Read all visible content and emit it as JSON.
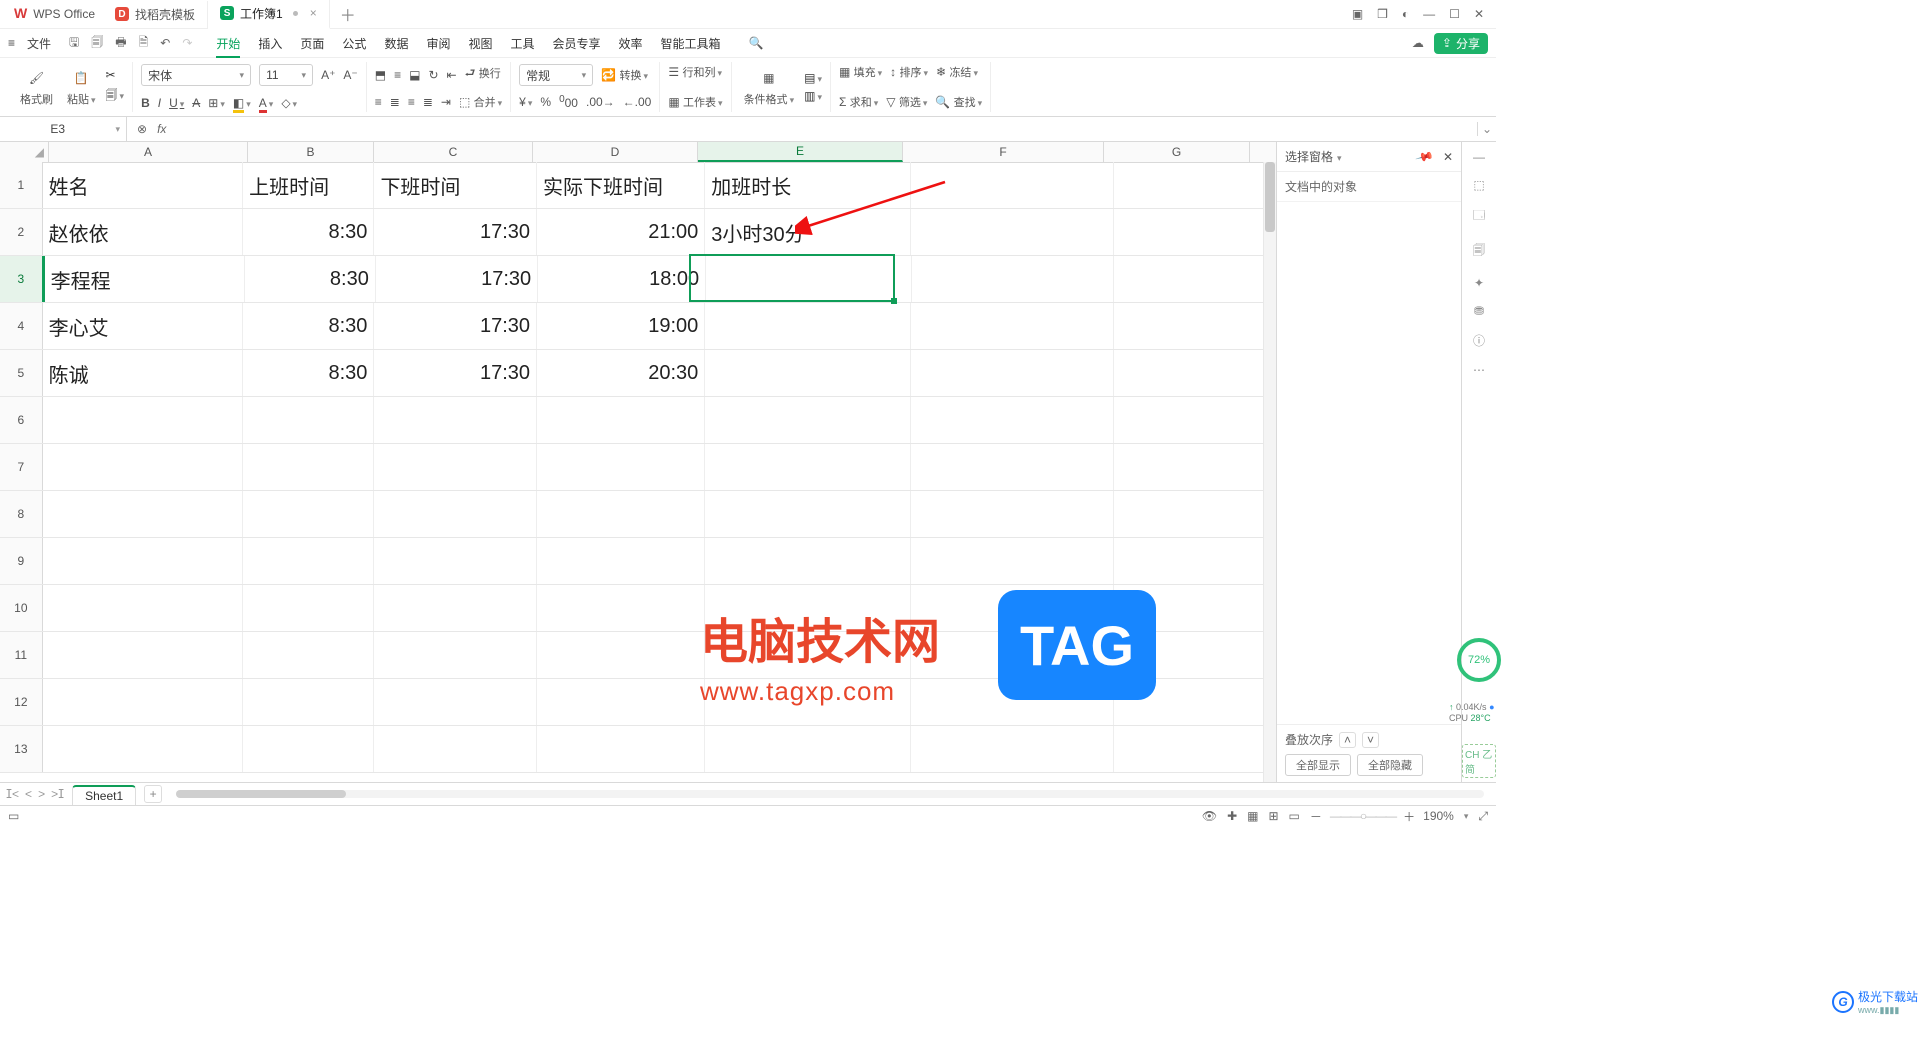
{
  "titlebar": {
    "brand": "WPS Office",
    "tabs": [
      {
        "icon": "red",
        "icon_text": "D",
        "label": "找稻壳模板"
      },
      {
        "icon": "green",
        "icon_text": "S",
        "label": "工作簿1",
        "active": true,
        "dirty": true
      }
    ]
  },
  "menubar": {
    "file": "文件",
    "tabs": [
      "开始",
      "插入",
      "页面",
      "公式",
      "数据",
      "审阅",
      "视图",
      "工具",
      "会员专享",
      "效率",
      "智能工具箱"
    ],
    "active_tab": "开始",
    "share": "分享"
  },
  "ribbon": {
    "format_painter": "格式刷",
    "paste": "粘贴",
    "font_name": "宋体",
    "font_size": "11",
    "wrap": "换行",
    "merge": "合并",
    "number_format": "常规",
    "convert": "转换",
    "rowcol": "行和列",
    "worksheet": "工作表",
    "cond_format": "条件格式",
    "fill": "填充",
    "sort": "排序",
    "freeze": "冻结",
    "sum": "求和",
    "filter": "筛选",
    "find": "查找"
  },
  "fxbar": {
    "namebox": "E3",
    "formula": ""
  },
  "sheet": {
    "active_cell": "E3",
    "columns": [
      "A",
      "B",
      "C",
      "D",
      "E",
      "F",
      "G"
    ],
    "selected_col": "E",
    "selected_row": 3,
    "row_headers": [
      1,
      2,
      3,
      4,
      5,
      6,
      7,
      8,
      9,
      10,
      11,
      12,
      13
    ],
    "headers": {
      "A": "姓名",
      "B": "上班时间",
      "C": "下班时间",
      "D": "实际下班时间",
      "E": "加班时长"
    },
    "rows": [
      {
        "A": "赵依依",
        "B": "8:30",
        "C": "17:30",
        "D": "21:00",
        "E": "3小时30分"
      },
      {
        "A": "李程程",
        "B": "8:30",
        "C": "17:30",
        "D": "18:00",
        "E": ""
      },
      {
        "A": "李心艾",
        "B": "8:30",
        "C": "17:30",
        "D": "19:00",
        "E": ""
      },
      {
        "A": "陈诚",
        "B": "8:30",
        "C": "17:30",
        "D": "20:30",
        "E": ""
      }
    ]
  },
  "taskpane": {
    "title": "选择窗格",
    "subtitle": "文档中的对象",
    "stack_order": "叠放次序",
    "show_all": "全部显示",
    "hide_all": "全部隐藏"
  },
  "gauge": {
    "value": "72",
    "unit": "%"
  },
  "sysmon": {
    "net": "0.04K/s",
    "cpu_label": "CPU",
    "cpu": "28°C"
  },
  "ime": "CH 乙简",
  "brand_dl": {
    "name": "极光下载站",
    "sub": "www.▮▮▮▮"
  },
  "sheettabs": {
    "active": "Sheet1"
  },
  "status": {
    "zoom": "190%"
  },
  "watermark": {
    "t1": "电脑技术网",
    "t2": "www.tagxp.com",
    "tag": "TAG"
  },
  "chart_data": {
    "type": "table",
    "title": "",
    "columns": [
      "姓名",
      "上班时间",
      "下班时间",
      "实际下班时间",
      "加班时长"
    ],
    "rows": [
      [
        "赵依依",
        "8:30",
        "17:30",
        "21:00",
        "3小时30分"
      ],
      [
        "李程程",
        "8:30",
        "17:30",
        "18:00",
        ""
      ],
      [
        "李心艾",
        "8:30",
        "17:30",
        "19:00",
        ""
      ],
      [
        "陈诚",
        "8:30",
        "17:30",
        "20:30",
        ""
      ]
    ]
  }
}
